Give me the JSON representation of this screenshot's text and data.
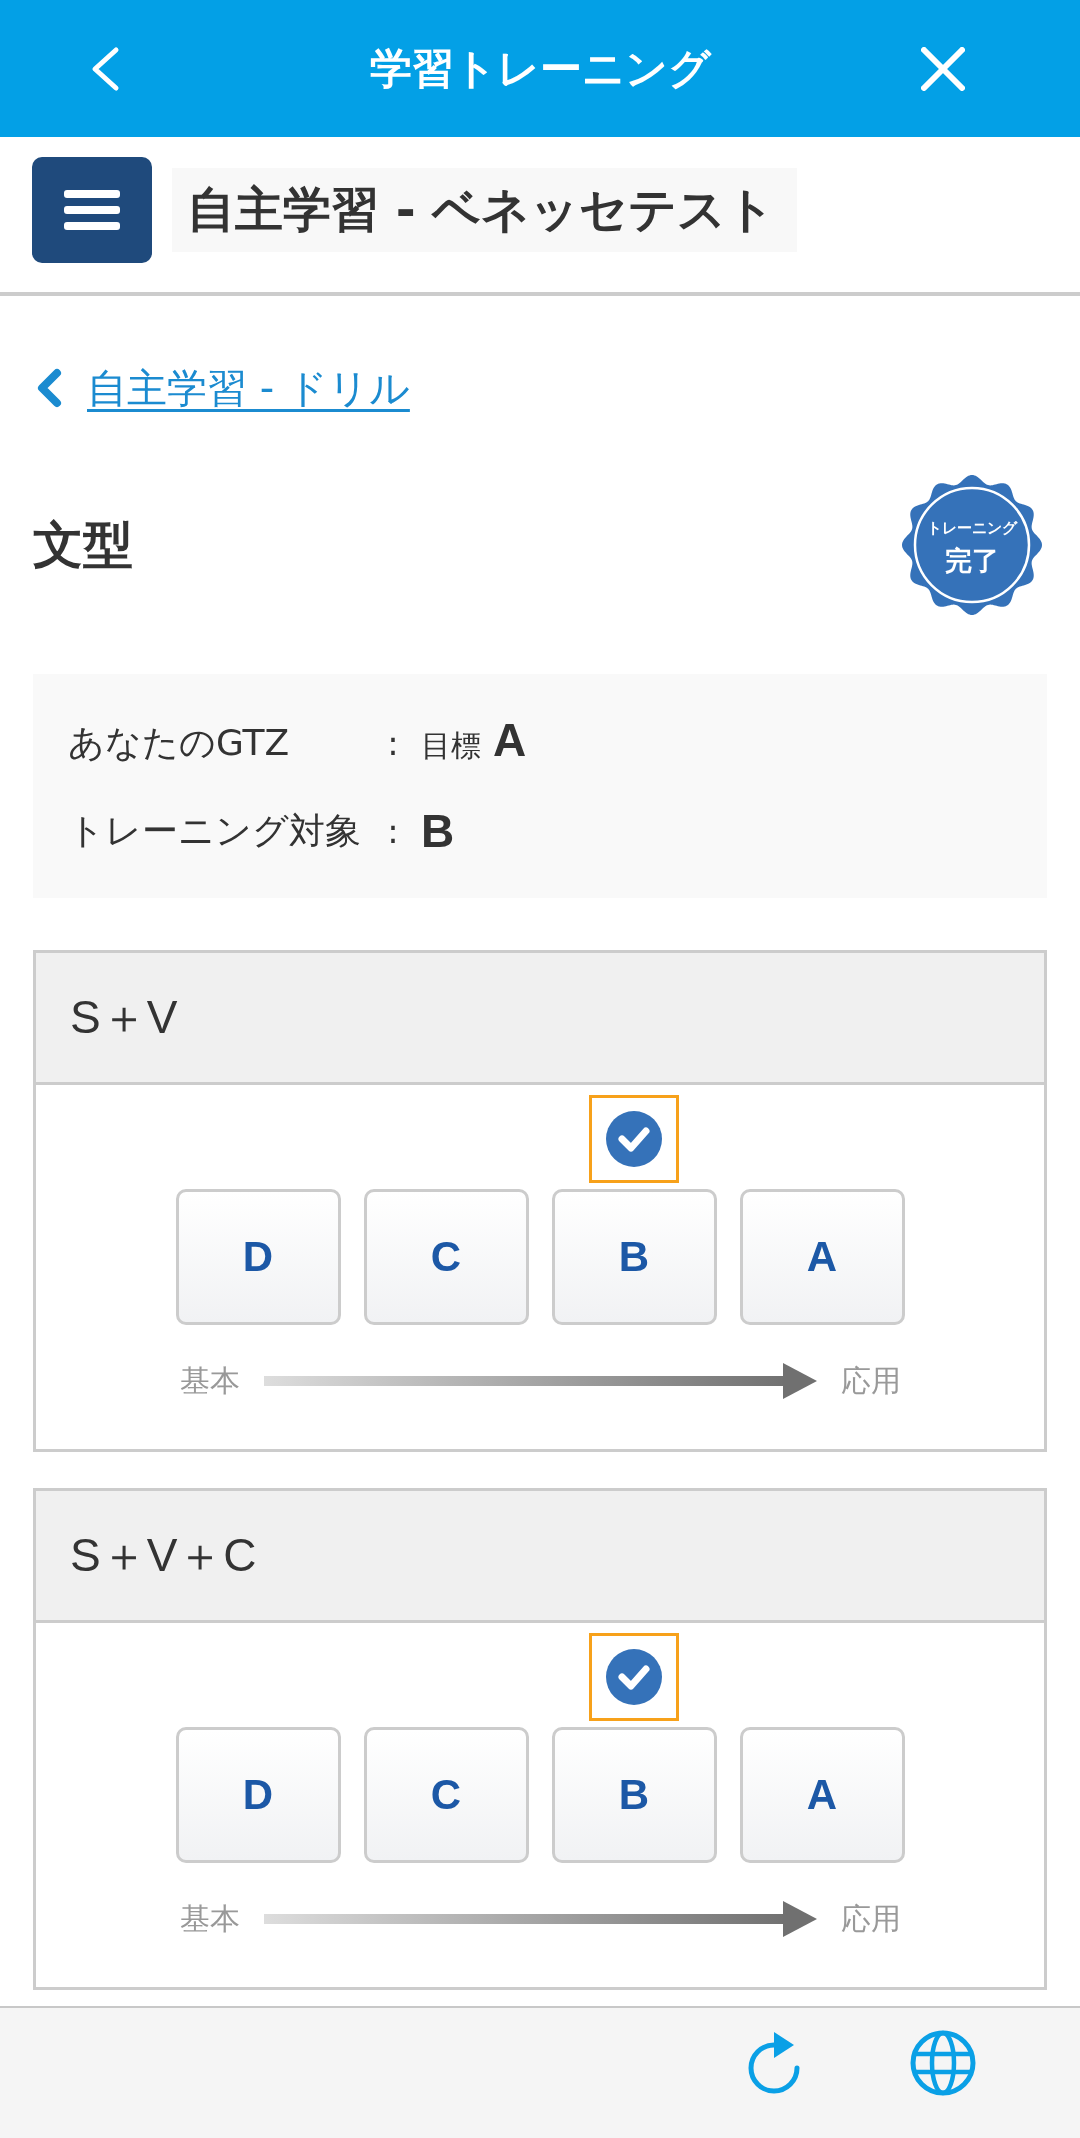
{
  "header": {
    "title": "学習トレーニング"
  },
  "site_bar": {
    "title": "自主学習 - ベネッセテスト"
  },
  "back_link": {
    "label": "自主学習 - ドリル"
  },
  "section": {
    "title": "文型",
    "badge": {
      "line_1": "トレーニング",
      "line_2": "完了"
    }
  },
  "summary": {
    "rows": [
      {
        "label": "あなたのGTZ",
        "separator": ":",
        "prefix": "目標",
        "value": "A"
      },
      {
        "label": "トレーニング対象",
        "separator": ":",
        "value": "B"
      }
    ]
  },
  "cards": [
    {
      "title": "S＋V",
      "levels": [
        {
          "label": "D",
          "selected": false
        },
        {
          "label": "C",
          "selected": false
        },
        {
          "label": "B",
          "selected": true
        },
        {
          "label": "A",
          "selected": false
        }
      ],
      "axis_start": "基本",
      "axis_end": "応用"
    },
    {
      "title": "S＋V＋C",
      "levels": [
        {
          "label": "D",
          "selected": false
        },
        {
          "label": "C",
          "selected": false
        },
        {
          "label": "B",
          "selected": true
        },
        {
          "label": "A",
          "selected": false
        }
      ],
      "axis_start": "基本",
      "axis_end": "応用"
    }
  ]
}
